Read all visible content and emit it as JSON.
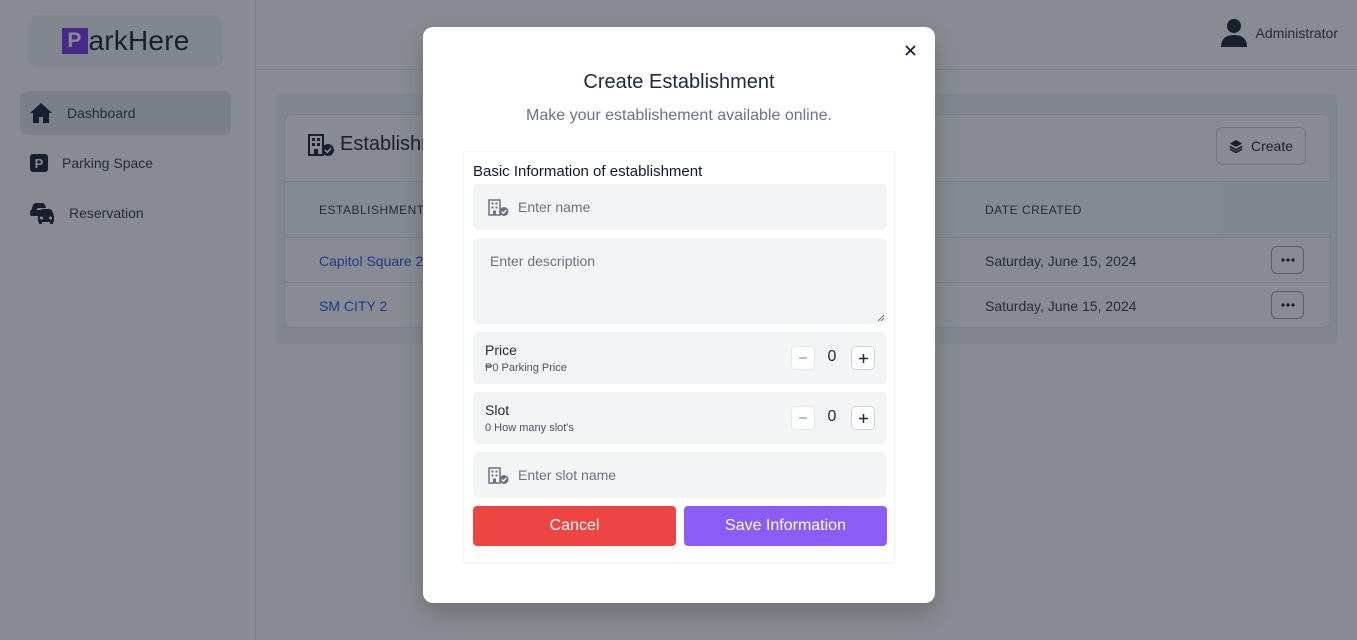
{
  "app": {
    "logo_letter": "P",
    "logo_rest": "arkHere"
  },
  "sidebar": {
    "items": [
      {
        "label": "Dashboard",
        "icon": "home-icon"
      },
      {
        "label": "Parking Space",
        "icon": "parking-icon"
      },
      {
        "label": "Reservation",
        "icon": "cars-icon"
      }
    ]
  },
  "header": {
    "user_name": "Administrator",
    "user_icon": "user-icon"
  },
  "main": {
    "title": "Establishments",
    "create_label": "Create",
    "columns": [
      "ESTABLISHMENT NAME",
      "DATE CREATED"
    ],
    "rows": [
      {
        "name": "Capitol Square 2",
        "date": "Saturday, June 15, 2024"
      },
      {
        "name": "SM CITY 2",
        "date": "Saturday, June 15, 2024"
      }
    ]
  },
  "modal": {
    "title": "Create Establishment",
    "subtitle": "Make your establishement available online.",
    "section_heading": "Basic Information of establishment",
    "name_placeholder": "Enter name",
    "description_placeholder": "Enter description",
    "price": {
      "label": "Price",
      "sub": "₱0 Parking Price",
      "value": "0"
    },
    "slot": {
      "label": "Slot",
      "sub": "0 How many slot's",
      "value": "0"
    },
    "slot_name_placeholder": "Enter slot name",
    "cancel_label": "Cancel",
    "save_label": "Save Information"
  },
  "colors": {
    "brand": "#7c3aed",
    "cancel": "#ef4444",
    "save": "#8b5cf6",
    "link": "#2563eb"
  }
}
